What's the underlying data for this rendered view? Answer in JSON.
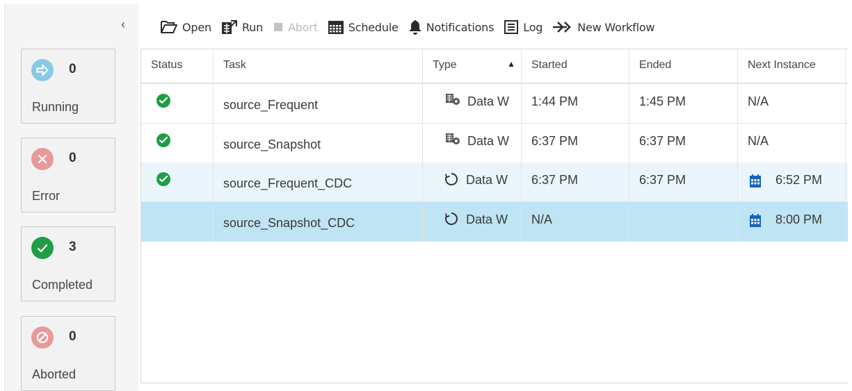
{
  "sidebar": {
    "collapse_glyph": "‹",
    "cards": [
      {
        "id": "running",
        "count": "0",
        "label": "Running",
        "icon": "arrow-right-icon",
        "color": "#89c9e6"
      },
      {
        "id": "error",
        "count": "0",
        "label": "Error",
        "icon": "x-icon",
        "color": "#e79a9a"
      },
      {
        "id": "completed",
        "count": "3",
        "label": "Completed",
        "icon": "checkmark-icon",
        "color": "#1e9e45"
      },
      {
        "id": "aborted",
        "count": "0",
        "label": "Aborted",
        "icon": "no-entry-icon",
        "color": "#e79a9a"
      }
    ]
  },
  "toolbar": {
    "open_label": "Open",
    "run_label": "Run",
    "abort_label": "Abort",
    "schedule_label": "Schedule",
    "notifications_label": "Notifications",
    "log_label": "Log",
    "new_workflow_label": "New Workflow"
  },
  "table": {
    "columns": [
      "Status",
      "Task",
      "Type",
      "Started",
      "Ended",
      "Next Instance"
    ],
    "sort_glyph": "▲",
    "rows": [
      {
        "status": "completed",
        "task": "source_Frequent",
        "type_icon": "data-warehouse-icon",
        "type": "Data W",
        "started": "1:44 PM",
        "ended": "1:45 PM",
        "next": "N/A",
        "next_icon": ""
      },
      {
        "status": "completed",
        "task": "source_Snapshot",
        "type_icon": "data-warehouse-icon",
        "type": "Data W",
        "started": "6:37 PM",
        "ended": "6:37 PM",
        "next": "N/A",
        "next_icon": ""
      },
      {
        "status": "completed",
        "task": "source_Frequent_CDC",
        "type_icon": "cdc-refresh-icon",
        "type": "Data W",
        "started": "6:37 PM",
        "ended": "6:37 PM",
        "next": "6:52 PM",
        "next_icon": "calendar-icon"
      },
      {
        "status": "",
        "task": "source_Snapshot_CDC",
        "type_icon": "cdc-refresh-icon",
        "type": "Data W",
        "started": "N/A",
        "ended": "",
        "next": "8:00 PM",
        "next_icon": "calendar-icon"
      }
    ]
  },
  "colors": {
    "accent_blue": "#1565c0",
    "selected_row": "#bfe4f4",
    "hover_row": "#eaf6fb",
    "success_green": "#1e9e45"
  }
}
